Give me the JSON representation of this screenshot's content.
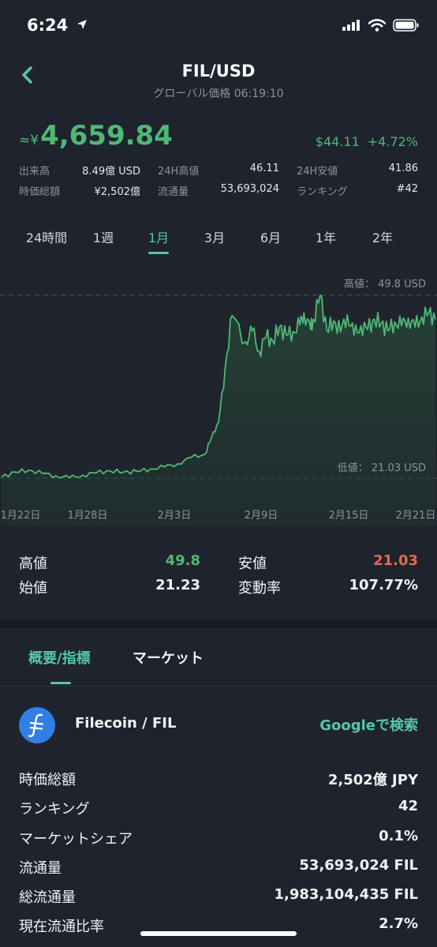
{
  "status_bar": {
    "time": "6:24"
  },
  "header": {
    "title": "FIL/USD",
    "subtitle": "グローバル価格 06:19:10"
  },
  "price": {
    "prefix": "≈¥",
    "value": "4,659.84",
    "change_abs": "$44.11",
    "change_pct": "+4.72%"
  },
  "stats": [
    [
      {
        "label": "出来高",
        "value": "8.49億 USD"
      },
      {
        "label": "24H高値",
        "value": "46.11"
      },
      {
        "label": "24H安値",
        "value": "41.86"
      }
    ],
    [
      {
        "label": "時価総額",
        "value": "¥2,502億"
      },
      {
        "label": "流通量",
        "value": "53,693,024"
      },
      {
        "label": "ランキング",
        "value": "#42"
      }
    ]
  ],
  "range_tabs": [
    "24時間",
    "1週",
    "1月",
    "3月",
    "6月",
    "1年",
    "2年"
  ],
  "active_range": "1月",
  "chart_data": {
    "type": "area",
    "x_tick_labels": [
      "1月22日",
      "1月28日",
      "2月3日",
      "2月9日",
      "2月15日",
      "2月21日"
    ],
    "high_label": "高値： 49.8 USD",
    "low_label": "低値： 21.03 USD",
    "high": 49.8,
    "low": 21.03,
    "ylim": [
      21.03,
      49.8
    ],
    "x_days": [
      0,
      1,
      2,
      3,
      4,
      5,
      6,
      7,
      8,
      9,
      10,
      11,
      12,
      13,
      14,
      15,
      15.5,
      16,
      16.5,
      17,
      18,
      18.5,
      19,
      19.5,
      20,
      20.5,
      21,
      21.5,
      22,
      22.3,
      22.8,
      23,
      23.5,
      24,
      24.5,
      25,
      25.5,
      26,
      26.5,
      27,
      27.5,
      28,
      28.5,
      29,
      29.5,
      30,
      30.5,
      31,
      31.5,
      32
    ],
    "values": [
      21.2,
      22.0,
      22.3,
      21.8,
      21.4,
      21.1,
      21.5,
      21.9,
      22.2,
      22.0,
      22.1,
      22.5,
      22.8,
      23.3,
      24.3,
      24.8,
      27.5,
      29.8,
      38.5,
      46.6,
      42.5,
      44.2,
      41.0,
      43.2,
      42.6,
      44.8,
      43.5,
      44.1,
      45.1,
      47.0,
      44.4,
      46.0,
      49.8,
      44.2,
      45.8,
      44.0,
      46.7,
      43.5,
      45.0,
      44.4,
      46.0,
      45.4,
      44.2,
      45.6,
      45.0,
      46.2,
      44.8,
      46.4,
      47.0,
      46.0
    ]
  },
  "summary": {
    "high_label": "高値",
    "high_value": "49.8",
    "low_label": "安値",
    "low_value": "21.03",
    "open_label": "始値",
    "open_value": "21.23",
    "change_label": "変動率",
    "change_value": "107.77%"
  },
  "detail_tabs": [
    "概要/指標",
    "マーケット"
  ],
  "coin": {
    "name": "Filecoin / FIL",
    "icon_glyph": "⨍",
    "search_link": "Googleで検索"
  },
  "info": [
    {
      "label": "時価総額",
      "value": "2,502億 JPY"
    },
    {
      "label": "ランキング",
      "value": "42"
    },
    {
      "label": "マーケットシェア",
      "value": "0.1%"
    },
    {
      "label": "流通量",
      "value": "53,693,024 FIL"
    },
    {
      "label": "総流通量",
      "value": "1,983,104,435 FIL"
    },
    {
      "label": "現在流通比率",
      "value": "2.7%"
    }
  ],
  "colors": {
    "accent": "#57c6ae",
    "up": "#4fb876",
    "down": "#e46a4e",
    "background": "#1f232d",
    "coin_icon": "#2f7fe4"
  }
}
